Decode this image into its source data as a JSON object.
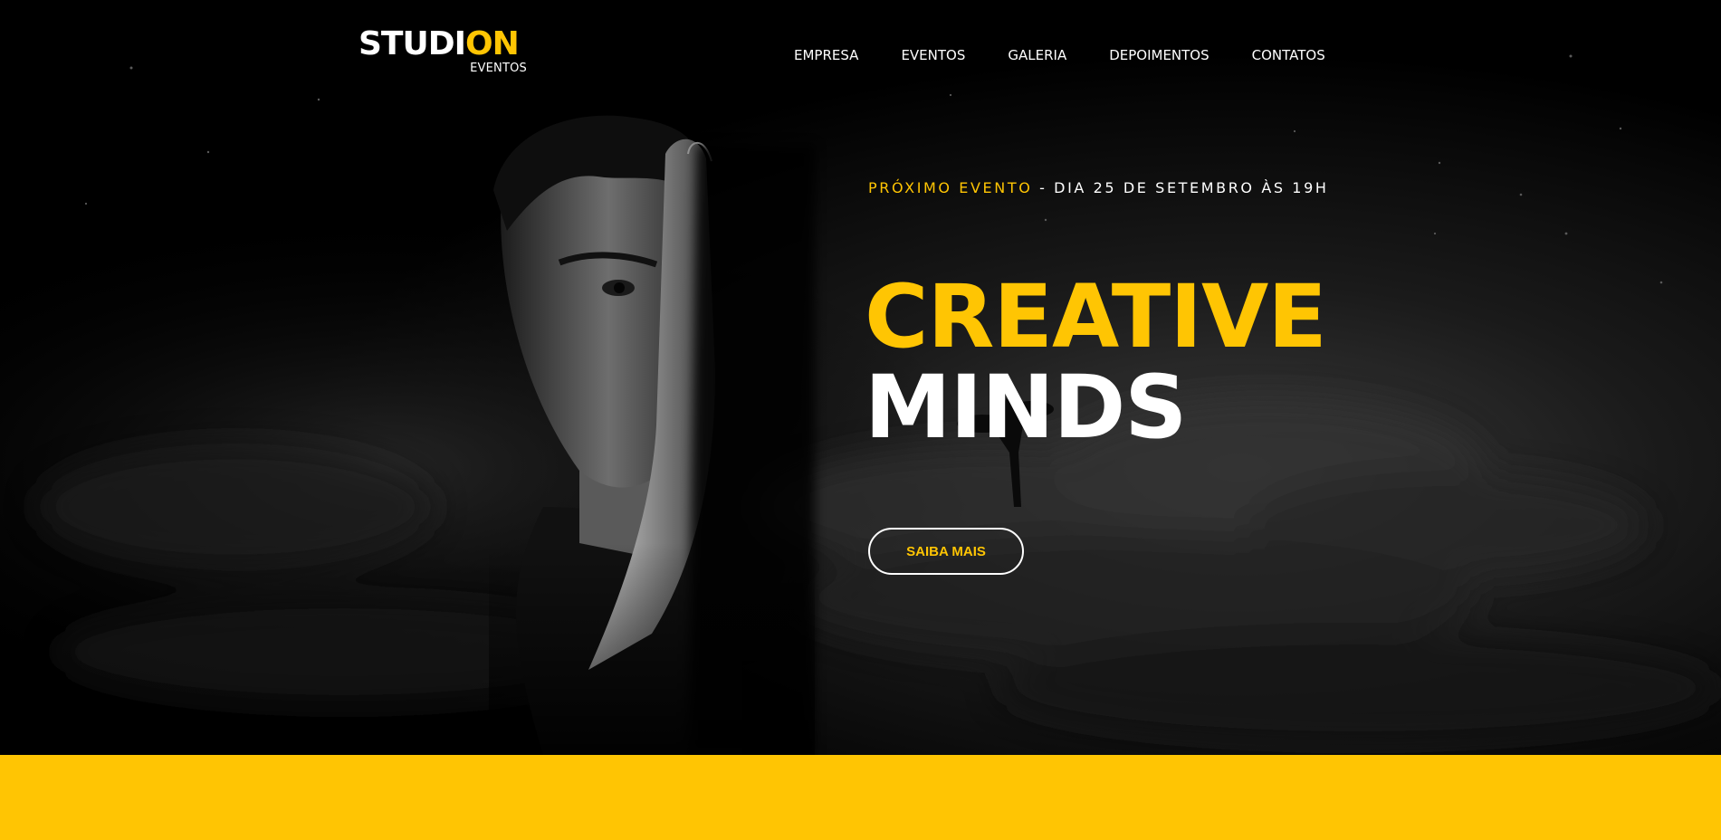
{
  "header": {
    "logo": {
      "part_white": "STUDI",
      "part_yellow": "ON",
      "subtitle": "EVENTOS"
    },
    "nav": {
      "items": [
        "EMPRESA",
        "EVENTOS",
        "GALERIA",
        "DEPOIMENTOS",
        "CONTATOS"
      ]
    }
  },
  "hero": {
    "event_label": "PRÓXIMO EVENTO",
    "event_separator": " - ",
    "event_date": "DIA 25 DE SETEMBRO ÀS 19H",
    "headline_line1": "CREATIVE",
    "headline_line2": "MINDS",
    "cta_label": "SAIBA MAIS"
  },
  "colors": {
    "accent": "#ffc503",
    "background": "#000000",
    "text": "#ffffff"
  }
}
